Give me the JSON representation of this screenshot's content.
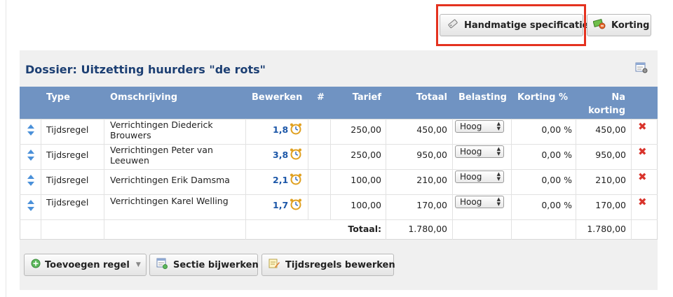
{
  "toolbar": {
    "manual_spec_label": "Handmatige specificatie",
    "discount_label": "Korting"
  },
  "dossier": {
    "title": "Dossier: Uitzetting huurders \"de rots\""
  },
  "table": {
    "headers": {
      "type": "Type",
      "description": "Omschrijving",
      "edit": "Bewerken",
      "number": "#",
      "rate": "Tarief",
      "total": "Totaal",
      "tax": "Belasting",
      "discount_pct": "Korting %",
      "after_discount_1": "Na",
      "after_discount_2": "korting"
    },
    "rows": [
      {
        "type": "Tijdsregel",
        "desc1": "Verrichtingen Diederick",
        "desc2": "Brouwers",
        "hours": "1,8",
        "rate": "250,00",
        "total": "450,00",
        "tax": "Hoog",
        "discount": "0,00 %",
        "after": "450,00"
      },
      {
        "type": "Tijdsregel",
        "desc1": "Verrichtingen Peter van",
        "desc2": "Leeuwen",
        "hours": "3,8",
        "rate": "250,00",
        "total": "950,00",
        "tax": "Hoog",
        "discount": "0,00 %",
        "after": "950,00"
      },
      {
        "type": "Tijdsregel",
        "desc1": "Verrichtingen Erik Damsma",
        "desc2": "",
        "hours": "2,1",
        "rate": "100,00",
        "total": "210,00",
        "tax": "Hoog",
        "discount": "0,00 %",
        "after": "210,00"
      },
      {
        "type": "Tijdsregel",
        "desc1": "Verrichtingen Karel Welling",
        "desc2": "",
        "hours": "1,7",
        "rate": "100,00",
        "total": "170,00",
        "tax": "Hoog",
        "discount": "0,00 %",
        "after": "170,00"
      }
    ],
    "totals": {
      "label": "Totaal:",
      "total": "1.780,00",
      "after": "1.780,00"
    }
  },
  "actions": {
    "add_line_label": "Toevoegen regel",
    "edit_section_label": "Sectie bijwerken",
    "edit_time_label": "Tijdsregels bewerken"
  },
  "colors": {
    "header_bg": "#7093c2",
    "title_color": "#1c3f73",
    "link_color": "#1c57a8",
    "highlight": "#e4321f",
    "delete_color": "#d9342c"
  }
}
